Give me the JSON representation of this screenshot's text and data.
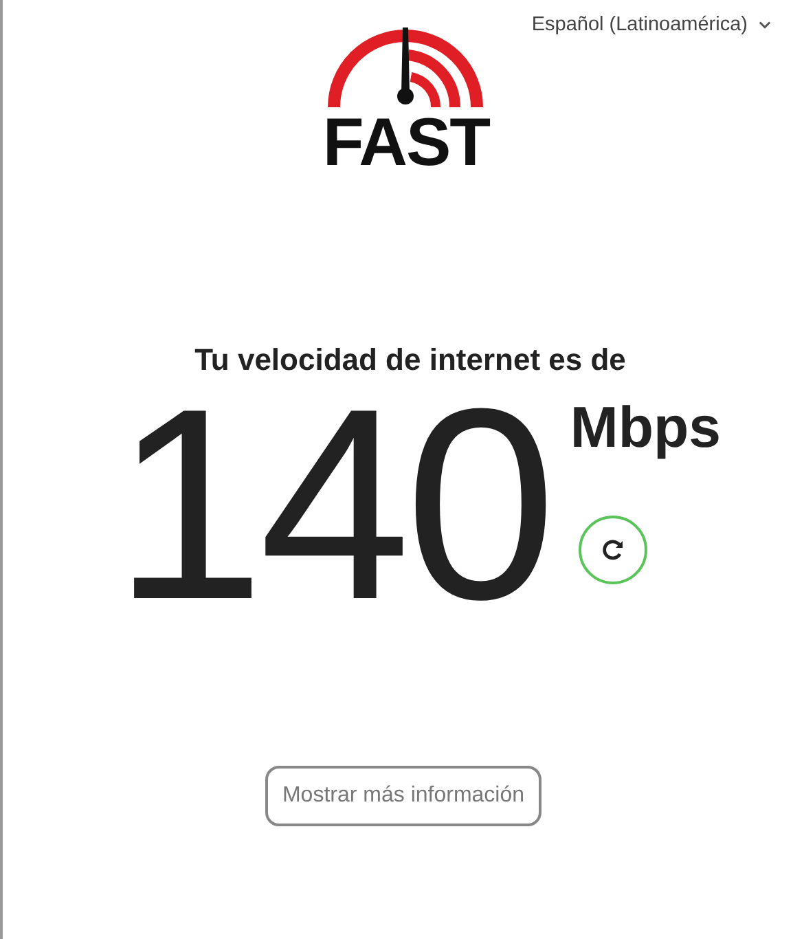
{
  "language_selector": {
    "label": "Español (Latinoamérica)"
  },
  "logo": {
    "text": "FAST"
  },
  "result": {
    "heading": "Tu velocidad de internet es de",
    "speed": "140",
    "unit": "Mbps"
  },
  "buttons": [
    {
      "label": "Mostrar más información"
    }
  ]
}
